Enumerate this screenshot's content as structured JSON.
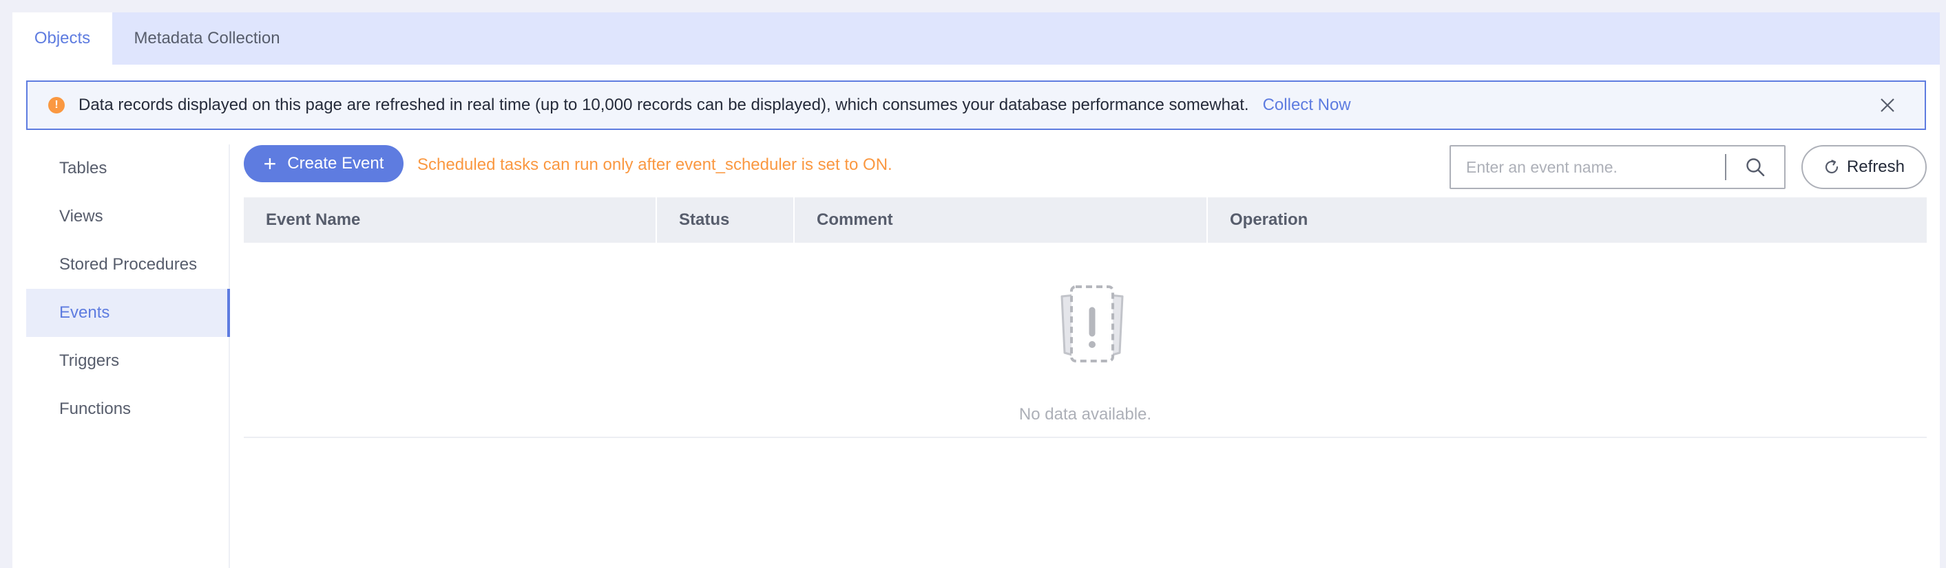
{
  "tabs": [
    {
      "label": "Objects",
      "active": true
    },
    {
      "label": "Metadata Collection",
      "active": false
    }
  ],
  "alert": {
    "text": "Data records displayed on this page are refreshed in real time (up to 10,000 records can be displayed), which consumes your database performance somewhat.",
    "link": "Collect Now"
  },
  "sidebar": {
    "items": [
      {
        "label": "Tables"
      },
      {
        "label": "Views"
      },
      {
        "label": "Stored Procedures"
      },
      {
        "label": "Events"
      },
      {
        "label": "Triggers"
      },
      {
        "label": "Functions"
      }
    ],
    "active_index": 3
  },
  "toolbar": {
    "create_label": "Create Event",
    "hint": "Scheduled tasks can run only after event_scheduler is set to ON.",
    "search_placeholder": "Enter an event name.",
    "refresh_label": "Refresh"
  },
  "table": {
    "columns": [
      "Event Name",
      "Status",
      "Comment",
      "Operation"
    ],
    "empty_text": "No data available."
  },
  "colors": {
    "accent": "#5e7ce0",
    "warning": "#fa9841",
    "tab_bar": "#dfe5fd",
    "header_bg": "#eceef3"
  }
}
